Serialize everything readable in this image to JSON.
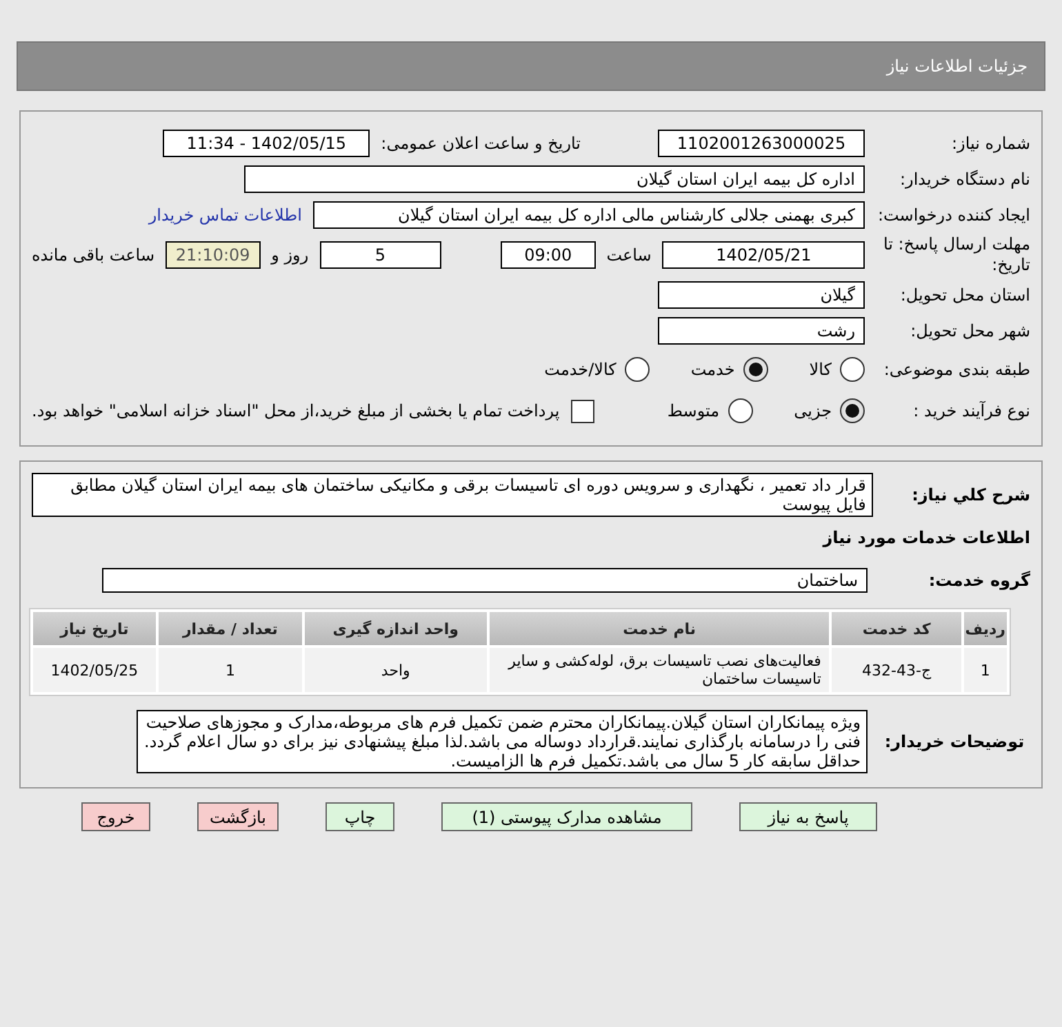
{
  "header": {
    "title": "جزئیات اطلاعات نیاز"
  },
  "need_number": {
    "label": "شماره نیاز:",
    "value": "1102001263000025"
  },
  "announce": {
    "label": "تاریخ و ساعت اعلان عمومی:",
    "value": "1402/05/15 - 11:34"
  },
  "buyer": {
    "label": "نام دستگاه خریدار:",
    "value": "اداره کل بیمه ایران استان گیلان"
  },
  "requester": {
    "label": "ایجاد کننده درخواست:",
    "value": "کبری بهمنی جلالی کارشناس مالی  اداره کل بیمه ایران استان گیلان",
    "link": "اطلاعات تماس خریدار"
  },
  "deadline": {
    "label": "مهلت ارسال پاسخ: تا تاریخ:",
    "date": "1402/05/21",
    "time_label": "ساعت",
    "time": "09:00",
    "days": "5",
    "days_label": "روز و",
    "remaining": "21:10:09",
    "remaining_label": "ساعت باقی مانده"
  },
  "province": {
    "label": "استان محل تحویل:",
    "value": "گیلان"
  },
  "city": {
    "label": "شهر محل تحویل:",
    "value": "رشت"
  },
  "category": {
    "label": "طبقه بندی موضوعی:",
    "options": [
      {
        "label": "کالا",
        "selected": false
      },
      {
        "label": "خدمت",
        "selected": true
      },
      {
        "label": "کالا/خدمت",
        "selected": false
      }
    ]
  },
  "process": {
    "label": "نوع فرآیند خرید :",
    "options": [
      {
        "label": "جزیی",
        "selected": true
      },
      {
        "label": "متوسط",
        "selected": false
      }
    ],
    "payment": {
      "label": "پرداخت تمام یا بخشی از مبلغ خرید،از محل \"اسناد خزانه اسلامی\" خواهد بود.",
      "checked": false
    }
  },
  "description": {
    "label": "شرح کلي نياز:",
    "value": "قرار داد تعمیر ، نگهداری و سرویس دوره ای تاسیسات برقی و مکانیکی ساختمان های بیمه ایران استان گیلان مطابق فایل پیوست"
  },
  "services_title": "اطلاعات خدمات مورد نیاز",
  "service_group": {
    "label": "گروه خدمت:",
    "value": "ساختمان"
  },
  "table": {
    "columns": [
      "ردیف",
      "کد خدمت",
      "نام خدمت",
      "واحد اندازه گیری",
      "تعداد / مقدار",
      "تاریخ نیاز"
    ],
    "rows": [
      [
        "1",
        "ج-43-432",
        "فعالیت‌های نصب تاسیسات برق، لوله‌کشی و سایر تاسیسات ساختمان",
        "واحد",
        "1",
        "1402/05/25"
      ]
    ]
  },
  "buyer_notes": {
    "label": "توضیحات خریدار:",
    "paragraphs": [
      "ویژه پیمانکاران استان گیلان.پیمانکاران محترم ضمن تکمیل فرم های مربوطه،مدارک و مجوزهای صلاحیت فنی را درسامانه بارگذاری نمایند.قرارداد دوساله می باشد.لذا مبلغ پیشنهادی نیز برای دو سال اعلام گردد.",
      "حداقل سابقه کار 5 سال می باشد.تکمیل فرم ها الزامیست."
    ]
  },
  "buttons": [
    {
      "label": "پاسخ به نیاز",
      "kind": "normal"
    },
    {
      "label": "مشاهده مدارک پیوستی (1)",
      "kind": "normal"
    },
    {
      "label": "چاپ",
      "kind": "normal"
    },
    {
      "label": "بازگشت",
      "kind": "danger"
    },
    {
      "label": "خروج",
      "kind": "danger"
    }
  ]
}
